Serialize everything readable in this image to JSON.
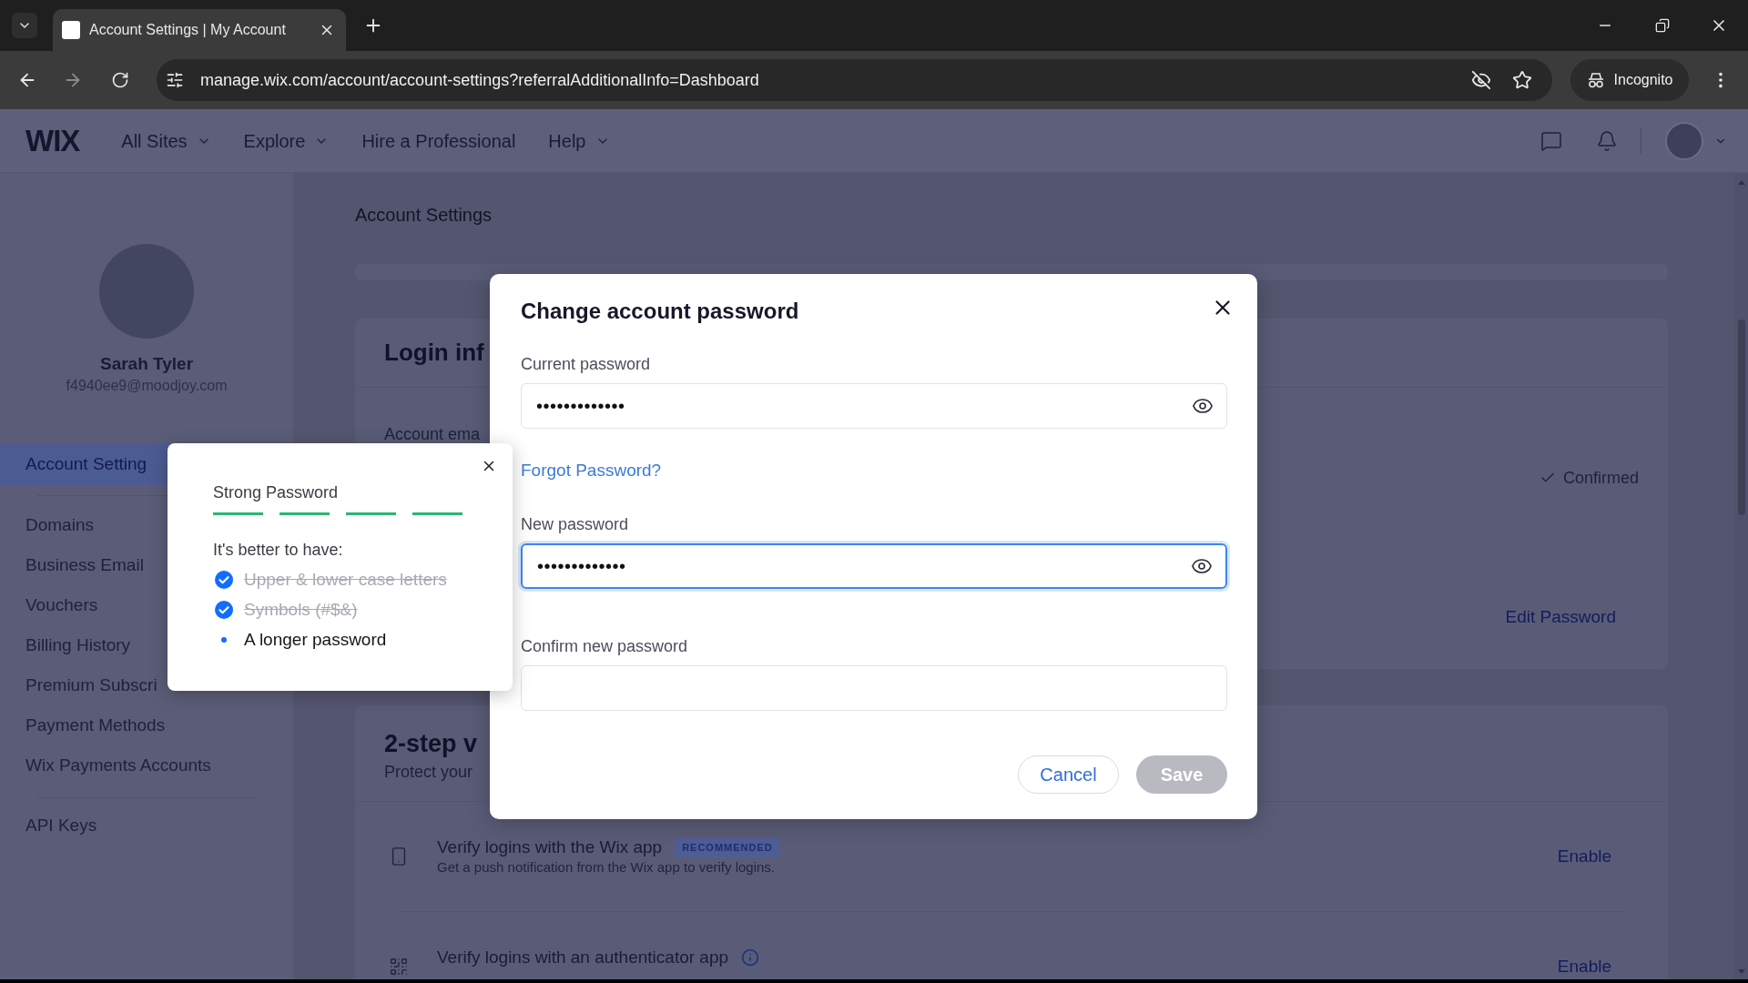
{
  "browser": {
    "tab_title": "Account Settings | My Account",
    "url": "manage.wix.com/account/account-settings?referralAdditionalInfo=Dashboard",
    "incognito_label": "Incognito"
  },
  "header": {
    "logo": "WIX",
    "nav": [
      {
        "label": "All Sites",
        "has_menu": true
      },
      {
        "label": "Explore",
        "has_menu": true
      },
      {
        "label": "Hire a Professional",
        "has_menu": false
      },
      {
        "label": "Help",
        "has_menu": true
      }
    ]
  },
  "sidebar": {
    "user": {
      "name": "Sarah Tyler",
      "email": "f4940ee9@moodjoy.com"
    },
    "sections": [
      {
        "items": [
          {
            "label": "Account Setting",
            "selected": true
          }
        ]
      },
      {
        "items": [
          {
            "label": "Domains",
            "selected": false
          },
          {
            "label": "Business Email",
            "selected": false
          },
          {
            "label": "Vouchers",
            "selected": false
          },
          {
            "label": "Billing History",
            "selected": false
          },
          {
            "label": "Premium Subscri",
            "selected": false
          },
          {
            "label": "Payment Methods",
            "selected": false
          },
          {
            "label": "Wix Payments Accounts",
            "selected": false
          }
        ]
      },
      {
        "items": [
          {
            "label": "API Keys",
            "selected": false
          }
        ]
      }
    ]
  },
  "page": {
    "title": "Account Settings",
    "login_card": {
      "title": "Login inf",
      "email_label": "Account ema",
      "status": "Confirmed",
      "action": "Edit Password"
    },
    "two_step_card": {
      "title": "2-step v",
      "subtitle": "Protect your",
      "methods": [
        {
          "kind": "phone",
          "title": "Verify logins with the Wix app",
          "badge": "RECOMMENDED",
          "info": false,
          "description": "Get a push notification from the Wix app to verify logins.",
          "action": "Enable"
        },
        {
          "kind": "authenticator",
          "title": "Verify logins with an authenticator app",
          "info": true,
          "action": "Enable"
        }
      ]
    }
  },
  "dialog": {
    "title": "Change account password",
    "fields": [
      {
        "label": "Current password",
        "value": "•••••••••••••",
        "focused": false,
        "reveal_toggle": true,
        "link": "Forgot Password?"
      },
      {
        "label": "New password",
        "value": "•••••••••••••",
        "focused": true,
        "reveal_toggle": true
      },
      {
        "label": "Confirm new password",
        "focused": false,
        "reveal_toggle": false
      }
    ],
    "buttons": [
      {
        "label": "Cancel",
        "kind": "secondary",
        "disabled": false
      },
      {
        "label": "Save",
        "kind": "primary",
        "disabled": true
      }
    ]
  },
  "password_tip": {
    "title": "Strong Password",
    "strength": {
      "level": 1
    },
    "hint": "It's better to have:",
    "rules": [
      {
        "text": "Upper & lower case letters",
        "met": true
      },
      {
        "text": "Symbols (#$&)",
        "met": true
      },
      {
        "text": "A longer password",
        "met": false
      }
    ]
  }
}
